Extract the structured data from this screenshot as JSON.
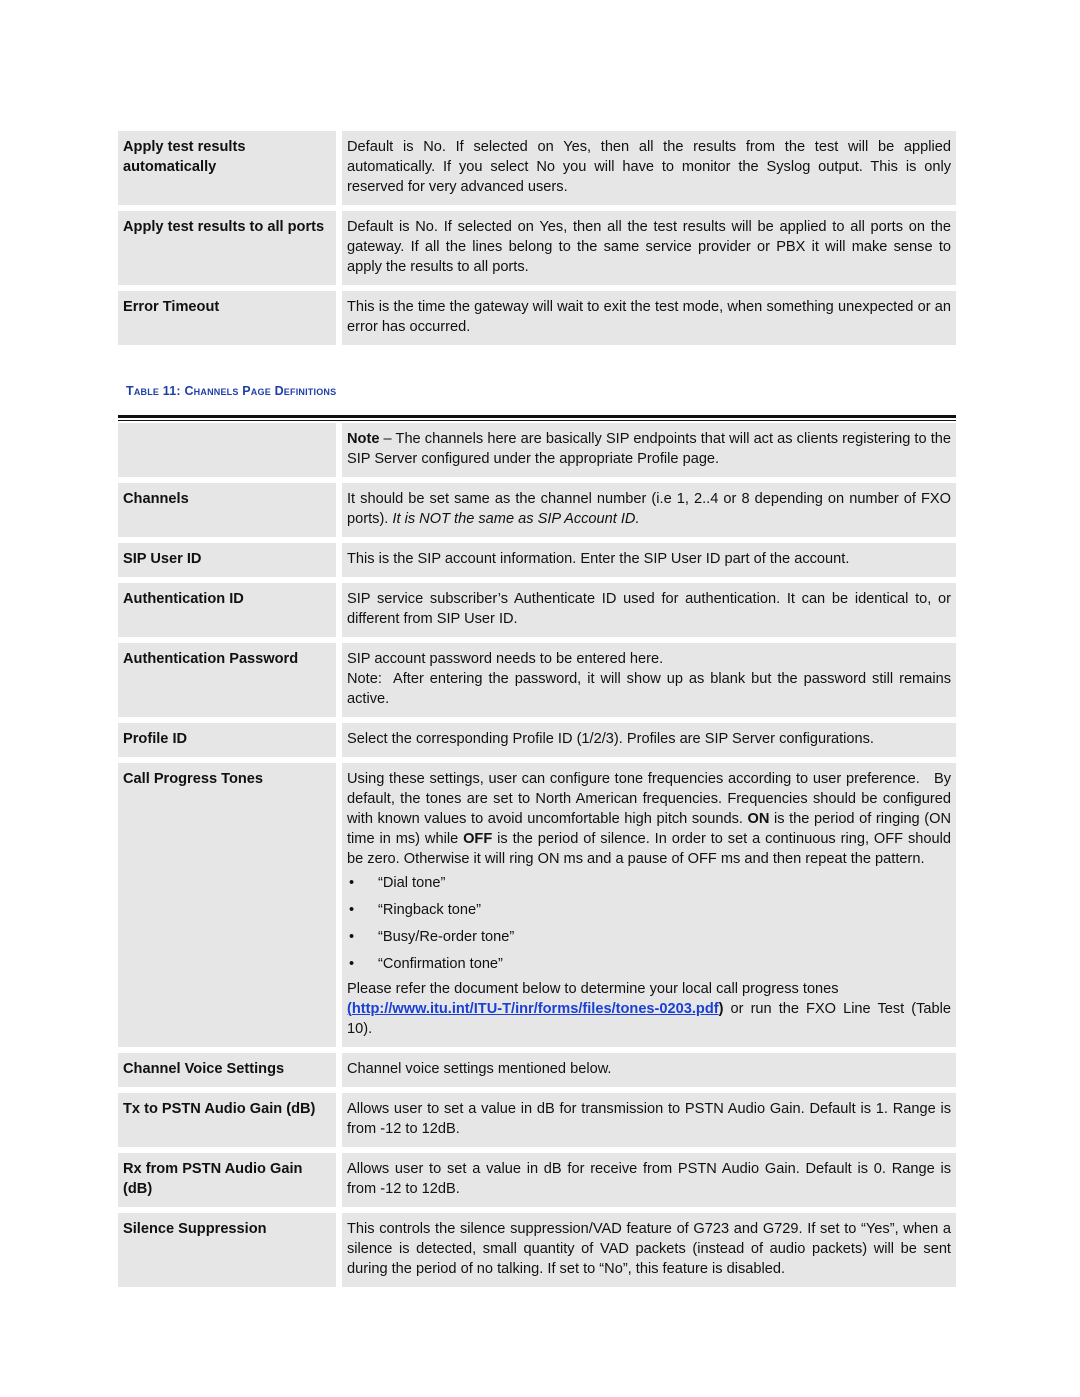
{
  "table10_tail": {
    "rows": [
      {
        "term": "Apply test results automatically",
        "description": "Default is No. If selected on Yes, then all the results from the test will be applied automatically. If you select No you will have to monitor the Syslog output. This is only reserved for very advanced users."
      },
      {
        "term": "Apply test results to all ports",
        "description": "Default is No. If selected on Yes, then all the test results will be applied to all ports on the gateway. If all the lines belong to the same service provider or PBX it will make sense to apply the results to all ports."
      },
      {
        "term": "Error Timeout",
        "description": "This is the time the gateway will wait to exit the test mode, when something unexpected or an error has occurred."
      }
    ]
  },
  "table11": {
    "caption": "Table 11: Channels Page Definitions",
    "note": {
      "term": "",
      "bold_lead": "Note",
      "text": " – The channels here are basically SIP endpoints that will act as clients registering to the SIP Server configured under the appropriate Profile page."
    },
    "channels": {
      "term": "Channels",
      "text": "It should be set same as the channel number (i.e 1, 2..4 or 8 depending on number of FXO ports). ",
      "italic": "It is NOT the same as SIP Account ID."
    },
    "sip_user_id": {
      "term": "SIP User ID",
      "text": "This is the SIP account information. Enter the SIP User ID part of the account."
    },
    "auth_id": {
      "term": "Authentication ID",
      "text": "SIP service subscriber’s Authenticate ID used for authentication. It can be identical to, or different from SIP User ID."
    },
    "auth_password": {
      "term": "Authentication Password",
      "line1": "SIP account password needs to be entered here.",
      "line2": "Note:  After entering the password, it will show up as blank but the password still remains active."
    },
    "profile_id": {
      "term": "Profile ID",
      "text": "Select the corresponding Profile ID (1/2/3). Profiles are SIP Server configurations."
    },
    "call_progress": {
      "term": "Call Progress Tones",
      "p1": "Using these settings, user can configure tone frequencies according to user preference.   By default, the tones are set to North American frequencies. Frequencies should be configured with known values to avoid uncomfortable high pitch sounds. ",
      "on": "ON",
      "p2": " is the period of ringing (ON time in ms) while ",
      "off": "OFF",
      "p3": " is the period of silence. In order to set a continuous ring, OFF should be zero. Otherwise it will ring ON ms and a pause of OFF ms and then repeat the pattern.",
      "bullet": "•",
      "tones": [
        "“Dial tone”",
        "“Ringback tone”",
        "“Busy/Re-order tone”",
        "“Confirmation tone”"
      ],
      "refer": "Please refer the document below to determine your local call progress tones",
      "link_open": "(",
      "link": "http://www.itu.int/ITU-T/inr/forms/files/tones-0203.pdf",
      "link_close": ")",
      "after_link": " or run the FXO Line Test (Table 10)."
    },
    "channel_voice": {
      "term": "Channel Voice Settings",
      "text": "Channel voice settings mentioned below."
    },
    "tx_gain": {
      "term": "Tx to PSTN Audio Gain (dB)",
      "text": "Allows user to set a value in dB for transmission to PSTN Audio Gain. Default is 1. Range is from -12 to 12dB."
    },
    "rx_gain": {
      "term": "Rx from PSTN Audio Gain (dB)",
      "text": "Allows user to set a value in dB for receive from PSTN Audio Gain. Default is 0. Range is from -12 to 12dB."
    },
    "silence": {
      "term": "Silence Suppression",
      "text": "This controls the silence suppression/VAD feature of G723 and G729. If set to “Yes”, when a silence is detected, small quantity of VAD packets (instead of audio packets) will be sent during the period of no talking. If set to “No”, this feature is disabled."
    }
  },
  "colors": {
    "cell_bg": "#e6e6e6",
    "caption": "#1f3fa8",
    "link": "#1a3fd6"
  }
}
